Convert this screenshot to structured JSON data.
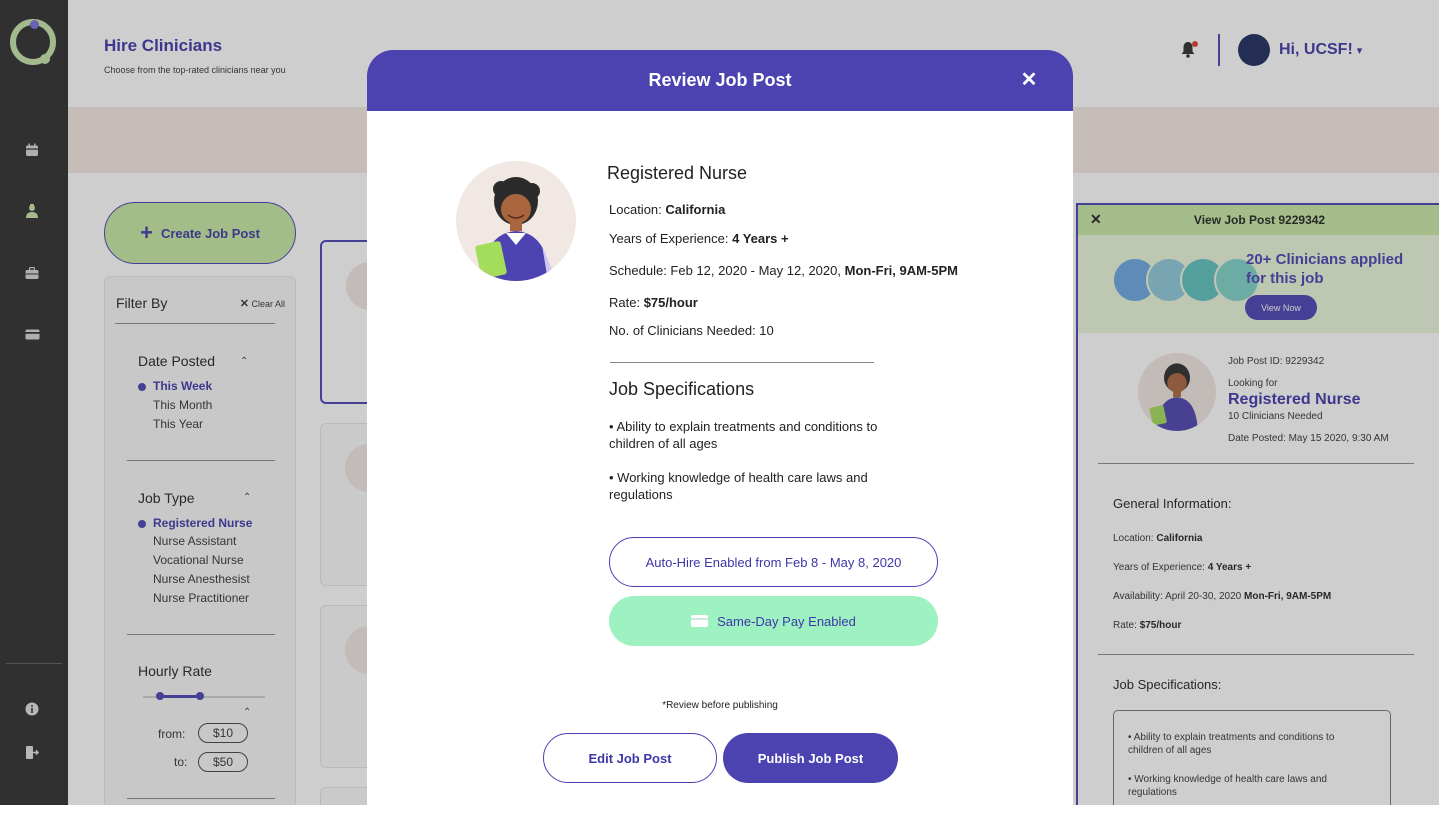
{
  "header": {
    "title": "Hire Clinicians",
    "subtitle": "Choose from the top-rated clinicians near you",
    "greeting": "Hi, UCSF!"
  },
  "sidebar": {
    "icons": [
      "calendar-icon",
      "clinician-icon",
      "briefcase-icon",
      "card-icon",
      "info-icon",
      "logout-icon"
    ]
  },
  "actions": {
    "create_job_post": "Create Job Post"
  },
  "filter": {
    "title": "Filter By",
    "clear_all": "Clear All",
    "date_posted": {
      "heading": "Date Posted",
      "options": [
        "This Week",
        "This Month",
        "This Year"
      ],
      "selected": "This Week"
    },
    "job_type": {
      "heading": "Job Type",
      "options": [
        "Registered Nurse",
        "Nurse Assistant",
        "Vocational Nurse",
        "Nurse Anesthesist",
        "Nurse Practitioner"
      ],
      "selected": "Registered Nurse"
    },
    "hourly_rate": {
      "heading": "Hourly Rate",
      "from_label": "from:",
      "from_value": "$10",
      "to_label": "to:",
      "to_value": "$50"
    }
  },
  "right_panel": {
    "title": "View Job Post 9229342",
    "applied_text": "20+ Clinicians applied for this job",
    "view_now": "View Now",
    "job_post_id": "Job Post ID: 9229342",
    "looking_for": "Looking for",
    "role": "Registered Nurse",
    "needed": "10 Clinicians Needed",
    "date_posted": "Date Posted: May 15 2020, 9:30 AM",
    "general_info_heading": "General Information:",
    "location_label": "Location: ",
    "location_value": "California",
    "experience_label": "Years of Experience: ",
    "experience_value": "4 Years +",
    "availability_label": "Availability: April 20-30, 2020 ",
    "availability_value": "Mon-Fri, 9AM-5PM",
    "rate_label": "Rate: ",
    "rate_value": "$75/hour",
    "spec_heading": "Job Specifications:",
    "spec_1": "• Ability to explain treatments and conditions to children of all ages",
    "spec_2": "• Working knowledge of health care laws and regulations"
  },
  "modal": {
    "title": "Review Job Post",
    "role": "Registered Nurse",
    "location_label": "Location: ",
    "location_value": "California",
    "experience_label": "Years of Experience: ",
    "experience_value": "4 Years +",
    "schedule_label": "Schedule: Feb 12, 2020 - May 12, 2020, ",
    "schedule_value": "Mon-Fri, 9AM-5PM",
    "rate_label": "Rate: ",
    "rate_value": "$75/hour",
    "clinicians_needed": "No. of Clinicians Needed: 10",
    "spec_heading": "Job Specifications",
    "spec_1": "• Ability to explain treatments and conditions to children of all ages",
    "spec_2": "• Working knowledge of health care laws and regulations",
    "auto_hire": "Auto-Hire Enabled from Feb 8 - May 8, 2020",
    "same_day_pay": "Same-Day Pay Enabled",
    "review_note": "*Review before publishing",
    "edit_button": "Edit Job Post",
    "publish_button": "Publish Job Post"
  },
  "colors": {
    "primary": "#4d43b0",
    "accent_green": "#c5e8a0",
    "mint": "#9ef2c2",
    "sidebar": "#2d2d2d"
  }
}
